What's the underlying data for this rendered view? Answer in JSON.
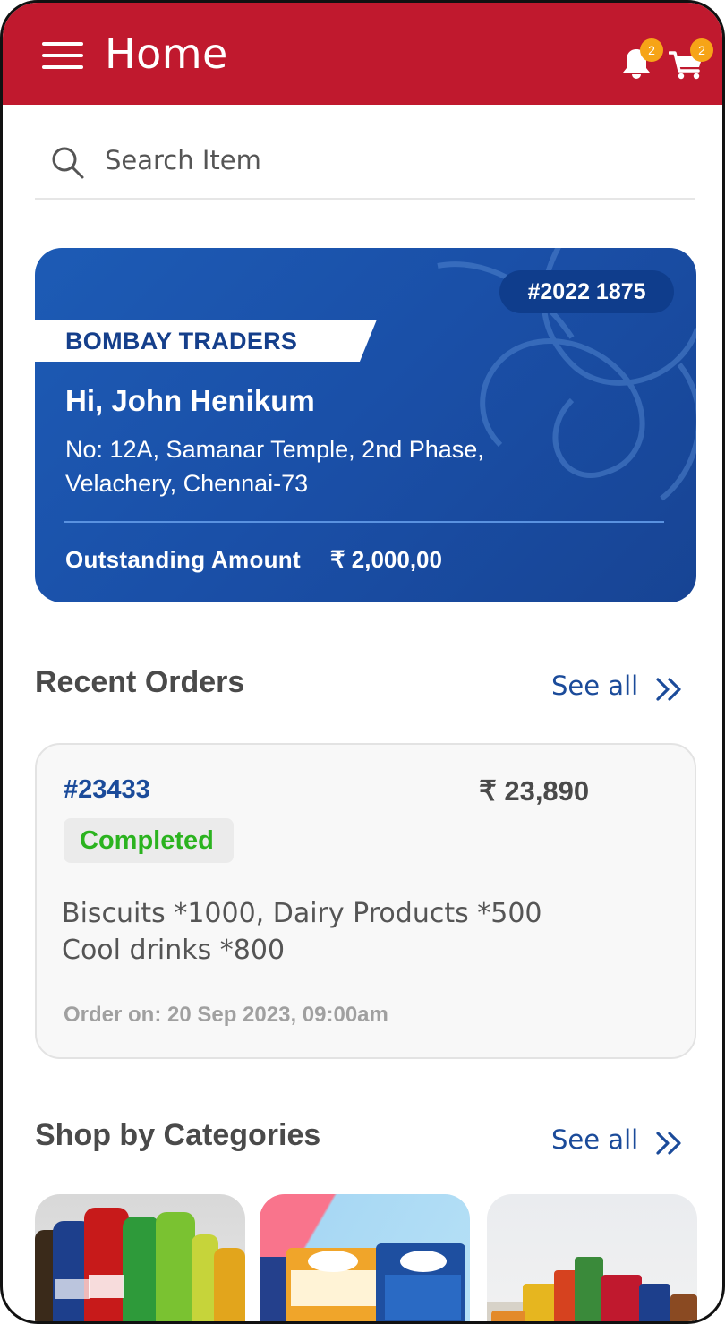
{
  "header": {
    "title": "Home",
    "notifications_count": "2",
    "cart_count": "2",
    "color": "#c0192e",
    "badge_color": "#f6a417"
  },
  "search": {
    "placeholder": "Search Item"
  },
  "profile_card": {
    "id": "#2022 1875",
    "shop_name": "BOMBAY TRADERS",
    "greeting": "Hi, John Henikum",
    "address_line1": "No: 12A, Samanar Temple, 2nd Phase,",
    "address_line2": "Velachery, Chennai-73",
    "outstanding_label": "Outstanding Amount",
    "outstanding_amount": "₹ 2,000,00",
    "color": "#1a4fa7"
  },
  "recent_orders": {
    "title": "Recent Orders",
    "see_all": "See all",
    "orders": [
      {
        "id": "#23433",
        "amount": "₹ 23,890",
        "status": "Completed",
        "items_line1": "Biscuits *1000, Dairy Products *500",
        "items_line2": "Cool drinks *800",
        "date": "Order on: 20 Sep 2023, 09:00am"
      }
    ]
  },
  "categories": {
    "title": "Shop by Categories",
    "see_all": "See all",
    "items": [
      {
        "icon": "cool-drinks-image"
      },
      {
        "icon": "dairy-products-image"
      },
      {
        "icon": "biscuits-image"
      }
    ]
  }
}
